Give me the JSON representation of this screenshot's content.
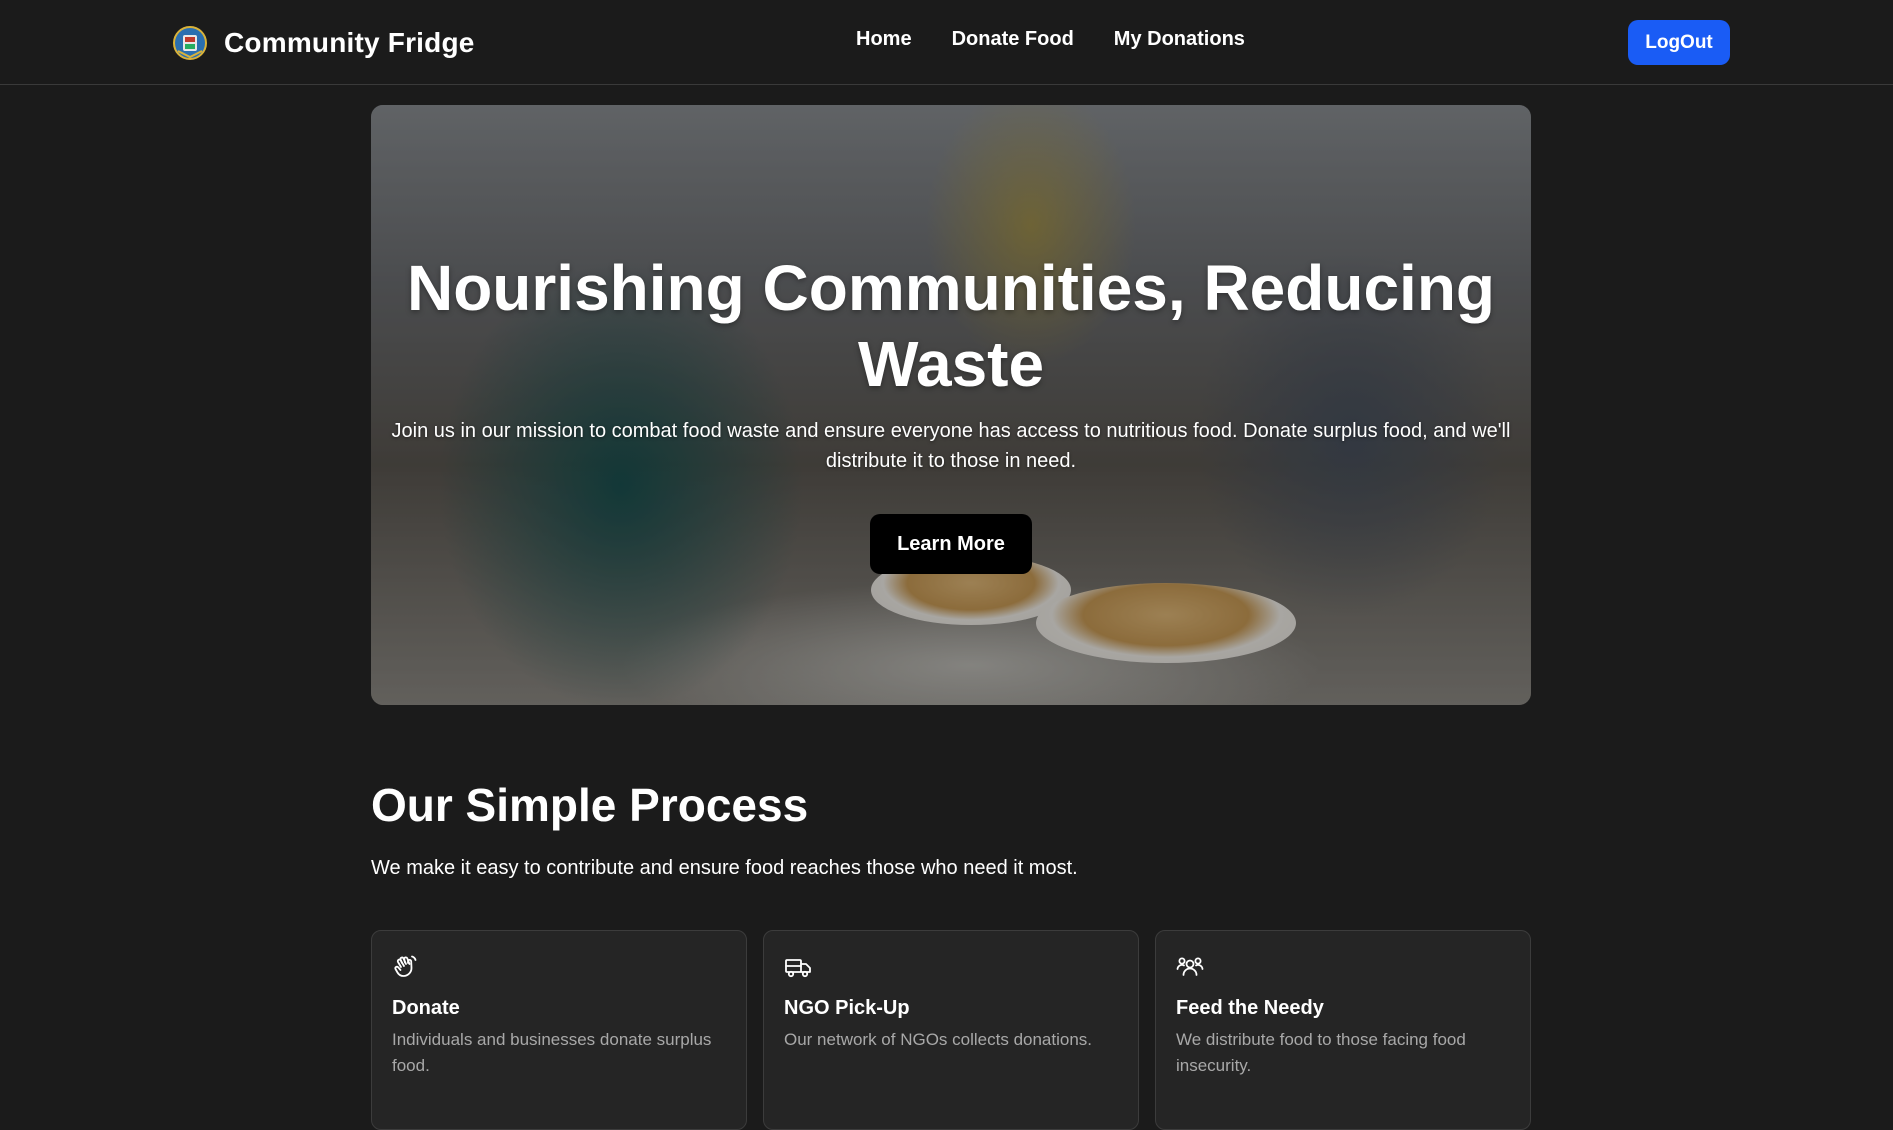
{
  "navbar": {
    "brand_name": "Community Fridge",
    "logo_icon": "community-emblem-icon",
    "links": [
      "Home",
      "Donate Food",
      "My Donations"
    ],
    "logout_label": "LogOut",
    "logout_color": "#1a5cf5"
  },
  "hero": {
    "title": "Nourishing Communities, Reducing Waste",
    "subtitle": "Join us in our mission to combat food waste and ensure everyone has access to nutritious food. Donate surplus food, and we'll distribute it to those in need.",
    "cta_label": "Learn More"
  },
  "process": {
    "title": "Our Simple Process",
    "subtitle": "We make it easy to contribute and ensure food reaches those who need it most.",
    "cards": [
      {
        "icon": "hand-wave-icon",
        "title": "Donate",
        "description": "Individuals and businesses donate surplus food."
      },
      {
        "icon": "truck-icon",
        "title": "NGO Pick-Up",
        "description": "Our network of NGOs collects donations."
      },
      {
        "icon": "people-group-icon",
        "title": "Feed the Needy",
        "description": "We distribute food to those facing food insecurity."
      }
    ]
  },
  "colors": {
    "background": "#1b1b1b",
    "card_background": "#252525",
    "accent": "#1a5cf5"
  }
}
